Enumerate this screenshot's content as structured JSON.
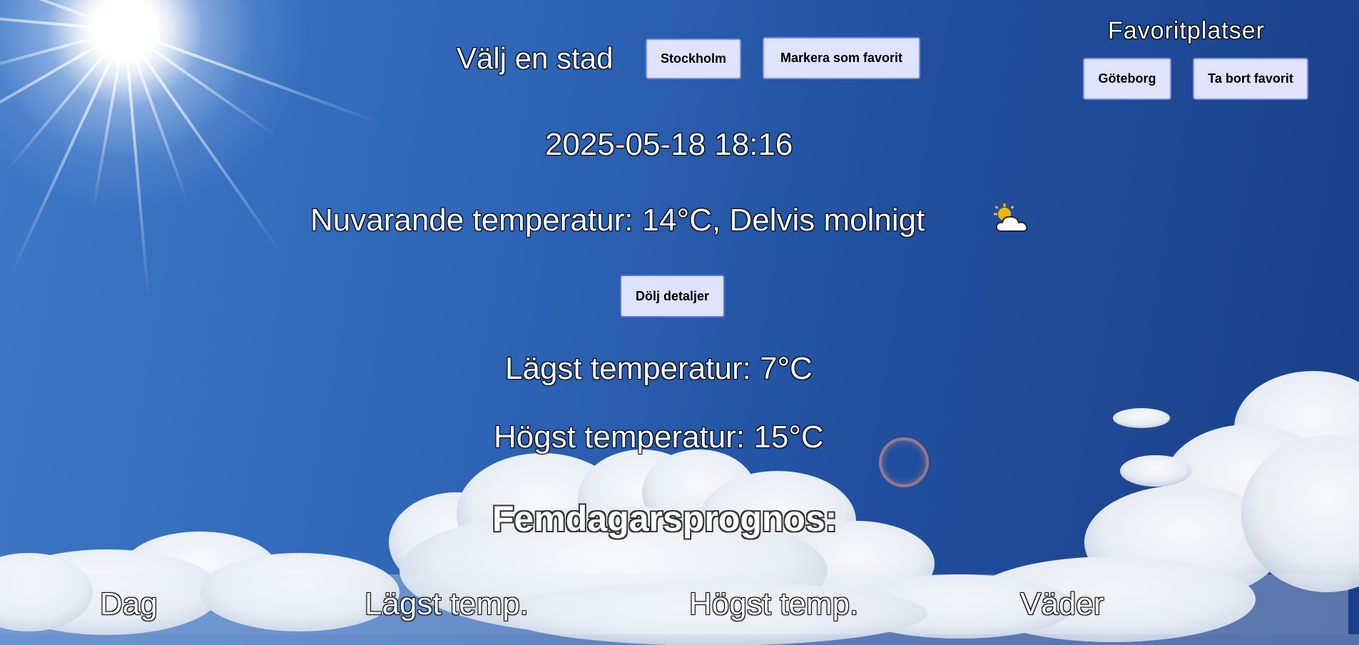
{
  "city_selector": {
    "label": "Välj en stad",
    "selected_city": "Stockholm",
    "favorite_button": "Markera som favorit"
  },
  "favorites": {
    "title": "Favoritplatser",
    "cities": [
      "Göteborg"
    ],
    "remove_button": "Ta bort favorit"
  },
  "datetime": "2025-05-18 18:16",
  "current_weather": {
    "text": "Nuvarande temperatur: 14°C, Delvis molnigt",
    "icon": "partly-cloudy-icon"
  },
  "details": {
    "toggle_button": "Dölj detaljer",
    "low": "Lägst temperatur: 7°C",
    "high": "Högst temperatur: 15°C"
  },
  "forecast": {
    "title": "Femdagarsprognos:",
    "columns": [
      "Dag",
      "Lägst temp.",
      "Högst temp.",
      "Väder"
    ]
  },
  "colors": {
    "button_bg": "#dfe3fb",
    "button_border": "#7d8fe6",
    "sky": "#2f66b8"
  }
}
